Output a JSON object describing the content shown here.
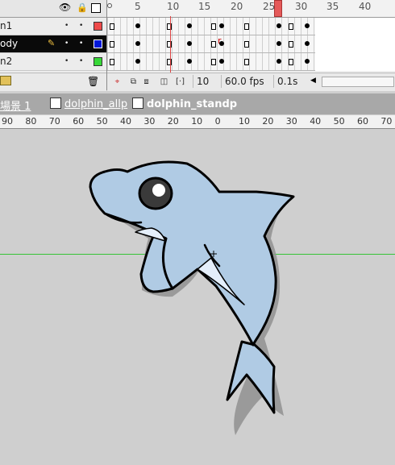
{
  "timeline": {
    "frame_numbers": [
      "5",
      "10",
      "15",
      "20",
      "25",
      "30",
      "35",
      "40"
    ],
    "layers": [
      {
        "name": "n1",
        "color": "#ef4a4a"
      },
      {
        "name": "ody",
        "color": "#0018d8"
      },
      {
        "name": "n2",
        "color": "#38d838"
      }
    ],
    "current_frame": "10",
    "frame_rate": "60.0 fps",
    "elapsed_time": "0.1s",
    "frame_label": "r"
  },
  "breadcrumb": {
    "scene": "場景 1",
    "symbol1": "dolphin_allp",
    "symbol2": "dolphin_standp"
  },
  "stage_ruler": [
    "90",
    "80",
    "70",
    "60",
    "50",
    "40",
    "30",
    "20",
    "10",
    "0",
    "10",
    "20",
    "30",
    "40",
    "50",
    "60",
    "70"
  ]
}
